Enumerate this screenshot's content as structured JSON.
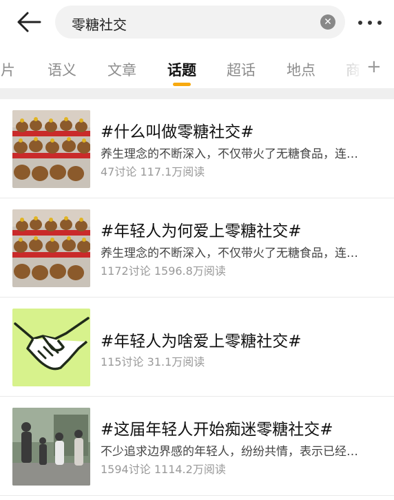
{
  "search": {
    "query": "零糖社交"
  },
  "tabs": [
    "图片",
    "语义",
    "文章",
    "话题",
    "超话",
    "地点",
    "商"
  ],
  "active_tab": "话题",
  "colors": {
    "accent": "#f7a90f",
    "muted": "#999999"
  },
  "results": [
    {
      "title": "#什么叫做零糖社交#",
      "desc": "养生理念的不断深入，不仅带火了无糖食品，连…",
      "discussions": "47讨论",
      "reads": "117.1万阅读",
      "thumb_icon": "plush-capybara-display-icon"
    },
    {
      "title": "#年轻人为何爱上零糖社交#",
      "desc": "养生理念的不断深入，不仅带火了无糖食品，连…",
      "discussions": "1172讨论",
      "reads": "1596.8万阅读",
      "thumb_icon": "plush-capybara-display-icon"
    },
    {
      "title": "#年轻人为啥爱上零糖社交#",
      "desc": "",
      "discussions": "115讨论",
      "reads": "31.1万阅读",
      "thumb_icon": "handshake-icon"
    },
    {
      "title": "#这届年轻人开始痴迷零糖社交#",
      "desc": "不少追求边界感的年轻人，纷纷共情，表示已经…",
      "discussions": "1594讨论",
      "reads": "1114.2万阅读",
      "thumb_icon": "people-outdoor-photo-icon"
    }
  ]
}
